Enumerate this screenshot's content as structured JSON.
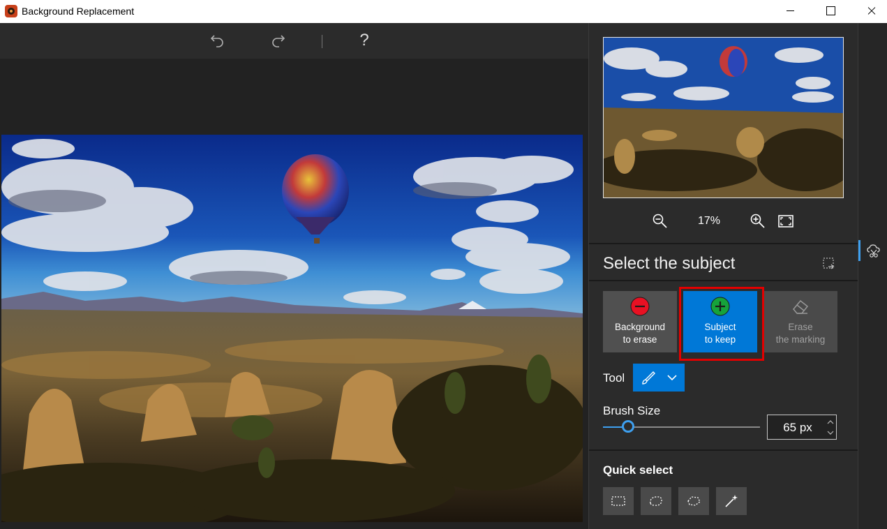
{
  "window": {
    "title": "Background Replacement"
  },
  "toolbar": {
    "undo_icon": "undo-icon",
    "redo_icon": "redo-icon",
    "help_label": "?"
  },
  "preview": {
    "zoom_level": "17%"
  },
  "select_subject": {
    "title": "Select the subject",
    "modes": [
      {
        "label_line1": "Background",
        "label_line2": "to erase",
        "icon": "minus-circle-icon",
        "color": "#e81123",
        "selected": false
      },
      {
        "label_line1": "Subject",
        "label_line2": "to keep",
        "icon": "plus-circle-icon",
        "color": "#16a33a",
        "selected": true
      },
      {
        "label_line1": "Erase",
        "label_line2": "the marking",
        "icon": "eraser-icon",
        "selected": false,
        "disabled": true
      }
    ],
    "tool_label": "Tool",
    "tool_value": "brush-icon",
    "brush_size_label": "Brush Size",
    "brush_size_value": "65 px",
    "brush_size_fraction": 0.16
  },
  "quick_select": {
    "title": "Quick select",
    "tools": [
      "rectangle-select-icon",
      "lasso-select-icon",
      "polygon-lasso-icon",
      "magic-wand-icon"
    ]
  },
  "colors": {
    "accent": "#0078d7",
    "highlight": "#e30000",
    "panel": "#2b2b2b"
  }
}
